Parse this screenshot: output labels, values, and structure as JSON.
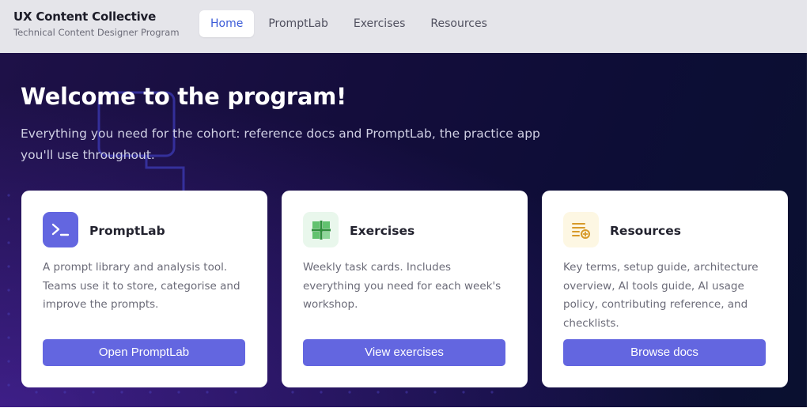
{
  "header": {
    "brand_title": "UX Content Collective",
    "brand_subtitle": "Technical Content Designer Program",
    "nav": [
      "Home",
      "PromptLab",
      "Exercises",
      "Resources"
    ],
    "active_nav": "Home"
  },
  "hero": {
    "title": "Welcome to the program!",
    "text": "Everything you need for the cohort: reference docs and PromptLab, the practice app you'll use throughout."
  },
  "cards": [
    {
      "title": "PromptLab",
      "icon": "terminal-icon",
      "description": "A prompt library and analysis tool. Teams use it to store, categorise and improve the prompts.",
      "button": "Open PromptLab"
    },
    {
      "title": "Exercises",
      "icon": "plus-grid-icon",
      "description": "Weekly task cards. Includes everything you need for each week's workshop.",
      "button": "View exercises"
    },
    {
      "title": "Resources",
      "icon": "document-list-icon",
      "description": "Key terms, setup guide, architecture overview, AI tools guide, AI usage policy, contributing reference, and checklists.",
      "button": "Browse docs"
    }
  ],
  "colors": {
    "accent": "#6366e0",
    "nav_active_text": "#3b5bd8",
    "hero_bg": "#140d3c"
  }
}
